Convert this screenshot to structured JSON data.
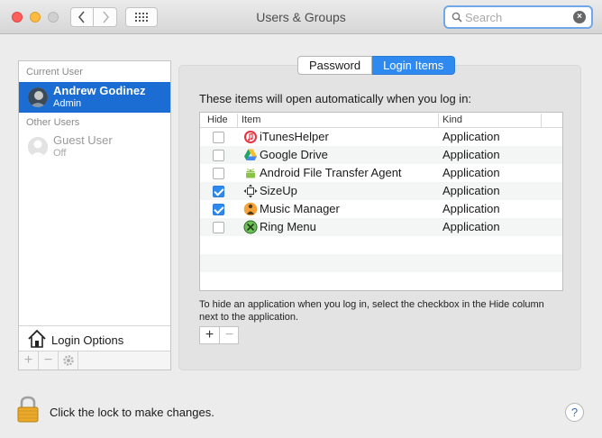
{
  "window": {
    "title": "Users & Groups"
  },
  "search": {
    "placeholder": "Search",
    "value": ""
  },
  "sidebar": {
    "current_user_label": "Current User",
    "current_user": {
      "name": "Andrew Godinez",
      "role": "Admin"
    },
    "other_users_label": "Other Users",
    "other_users": [
      {
        "name": "Guest User",
        "status": "Off"
      }
    ],
    "login_options_label": "Login Options",
    "tools": {
      "add": "+",
      "remove": "−"
    }
  },
  "tabs": [
    {
      "label": "Password",
      "active": false
    },
    {
      "label": "Login Items",
      "active": true
    }
  ],
  "login_items": {
    "intro": "These items will open automatically when you log in:",
    "columns": {
      "hide": "Hide",
      "item": "Item",
      "kind": "Kind"
    },
    "rows": [
      {
        "hide": false,
        "name": "iTunesHelper",
        "kind": "Application",
        "icon": "itunes-icon"
      },
      {
        "hide": false,
        "name": "Google Drive",
        "kind": "Application",
        "icon": "google-drive-icon"
      },
      {
        "hide": false,
        "name": "Android File Transfer Agent",
        "kind": "Application",
        "icon": "android-icon"
      },
      {
        "hide": true,
        "name": "SizeUp",
        "kind": "Application",
        "icon": "sizeup-icon"
      },
      {
        "hide": true,
        "name": "Music Manager",
        "kind": "Application",
        "icon": "music-manager-icon"
      },
      {
        "hide": false,
        "name": "Ring Menu",
        "kind": "Application",
        "icon": "ring-menu-icon"
      }
    ],
    "hint": "To hide an application when you log in, select the checkbox in the Hide column next to the application.",
    "add": "+",
    "remove": "−"
  },
  "footer": {
    "lock_text": "Click the lock to make changes.",
    "help": "?"
  },
  "colors": {
    "accent": "#2f8af0",
    "selection": "#1b6cd3"
  }
}
